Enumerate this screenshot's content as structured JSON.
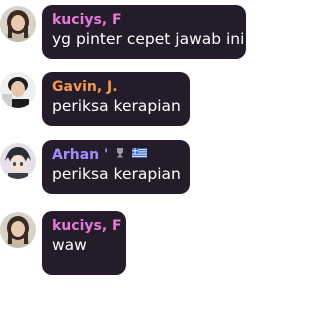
{
  "messages": [
    {
      "author": "kuciys, F",
      "author_color": "#e37bd6",
      "text": "yg pinter cepet jawab ini",
      "avatar": "girl-avatar-icon"
    },
    {
      "author": "Gavin, J.",
      "author_color": "#f29852",
      "text": "periksa kerapian",
      "avatar": "boy-avatar-icon"
    },
    {
      "author": "Arhan",
      "author_color": "#a48cff",
      "author_suffix": "'",
      "text": "periksa kerapian",
      "avatar": "anime-avatar-icon",
      "badges": [
        "trophy-icon",
        "greece-flag-icon"
      ]
    },
    {
      "author": "kuciys, F",
      "author_color": "#e37bd6",
      "text": "waw",
      "avatar": "girl-avatar-icon"
    }
  ]
}
